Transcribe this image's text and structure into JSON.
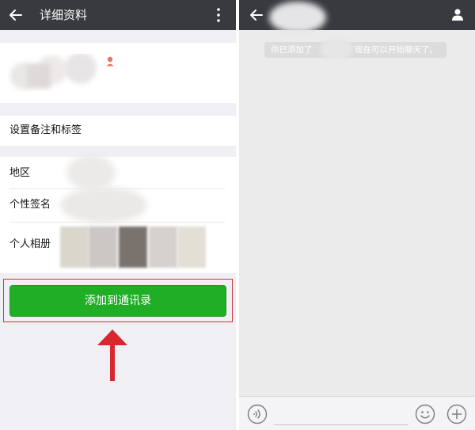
{
  "left": {
    "title": "详细资料",
    "rows": {
      "remark_tags": "设置备注和标签",
      "region": "地区",
      "signature": "个性签名",
      "album": "个人相册"
    },
    "add_button_label": "添加到通讯录"
  },
  "right": {
    "system_message": {
      "part_a": "你已添加了",
      "part_b": "现在可以开始聊天了。"
    },
    "input": {
      "value": "",
      "placeholder": ""
    }
  },
  "colors": {
    "top_bar": "#393a3f",
    "primary_green": "#20ae27",
    "highlight_red": "#c8393e",
    "arrow_red": "#d8272e",
    "page_bg": "#efeff4",
    "chat_bg": "#ebebeb"
  },
  "icons": [
    "back-arrow-icon",
    "more-vertical-icon",
    "gender-female-icon",
    "user-profile-icon",
    "voice-icon",
    "emoji-icon",
    "plus-icon"
  ]
}
